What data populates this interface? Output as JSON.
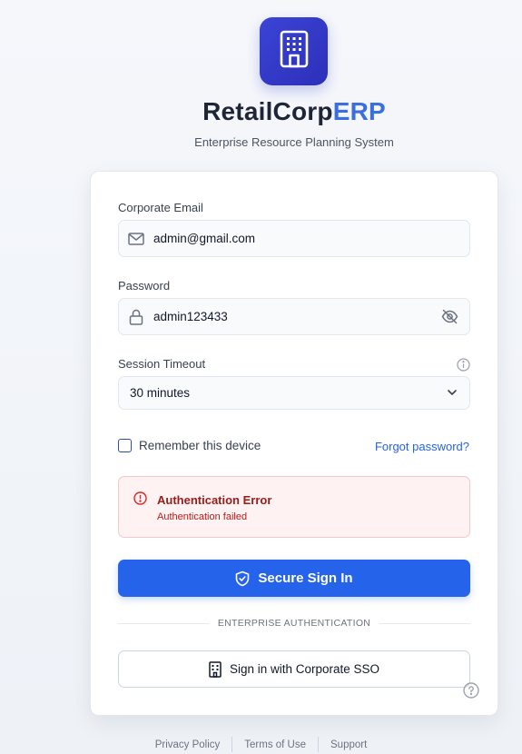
{
  "brand": {
    "name_main": "RetailCorp",
    "name_accent": "ERP",
    "tagline": "Enterprise Resource Planning System",
    "logo_icon": "building-icon"
  },
  "form": {
    "email": {
      "label": "Corporate Email",
      "value": "admin@gmail.com",
      "icon": "mail-icon"
    },
    "password": {
      "label": "Password",
      "value": "admin123433",
      "icon": "lock-icon",
      "toggle_icon": "eye-off-icon"
    },
    "session": {
      "label": "Session Timeout",
      "value": "30 minutes",
      "info_icon": "info-icon"
    },
    "remember_label": "Remember this device",
    "remember_checked": false,
    "forgot_link": "Forgot password?"
  },
  "alert": {
    "title": "Authentication Error",
    "message": "Authentication failed",
    "icon": "alert-circle-icon"
  },
  "actions": {
    "sign_in_label": "Secure Sign In",
    "divider_text": "ENTERPRISE AUTHENTICATION",
    "sso_label": "Sign in with Corporate SSO"
  },
  "footer": {
    "links": [
      "Privacy Policy",
      "Terms of Use",
      "Support"
    ]
  },
  "colors": {
    "primary": "#2563eb",
    "accent": "#3b6fe0",
    "error_text": "#991b1b",
    "error_bg": "#fef2f2"
  }
}
